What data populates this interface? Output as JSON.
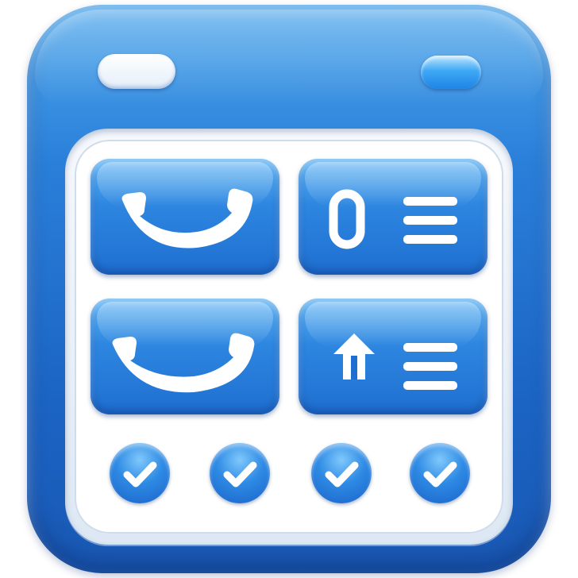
{
  "app_icon": {
    "tiles": [
      {
        "icon": "phone-handset-icon"
      },
      {
        "icon": "zero-list-icon",
        "glyph": "0"
      },
      {
        "icon": "phone-handset-icon"
      },
      {
        "icon": "upload-arrow-list-icon"
      }
    ],
    "checks": [
      {
        "icon": "checkmark-icon"
      },
      {
        "icon": "checkmark-icon"
      },
      {
        "icon": "checkmark-icon"
      },
      {
        "icon": "checkmark-icon"
      }
    ]
  },
  "colors": {
    "body_blue": "#2a7fd9",
    "tile_blue": "#2d86e0",
    "screen_white": "#ffffff",
    "accent_light": "#5fb4f4"
  }
}
